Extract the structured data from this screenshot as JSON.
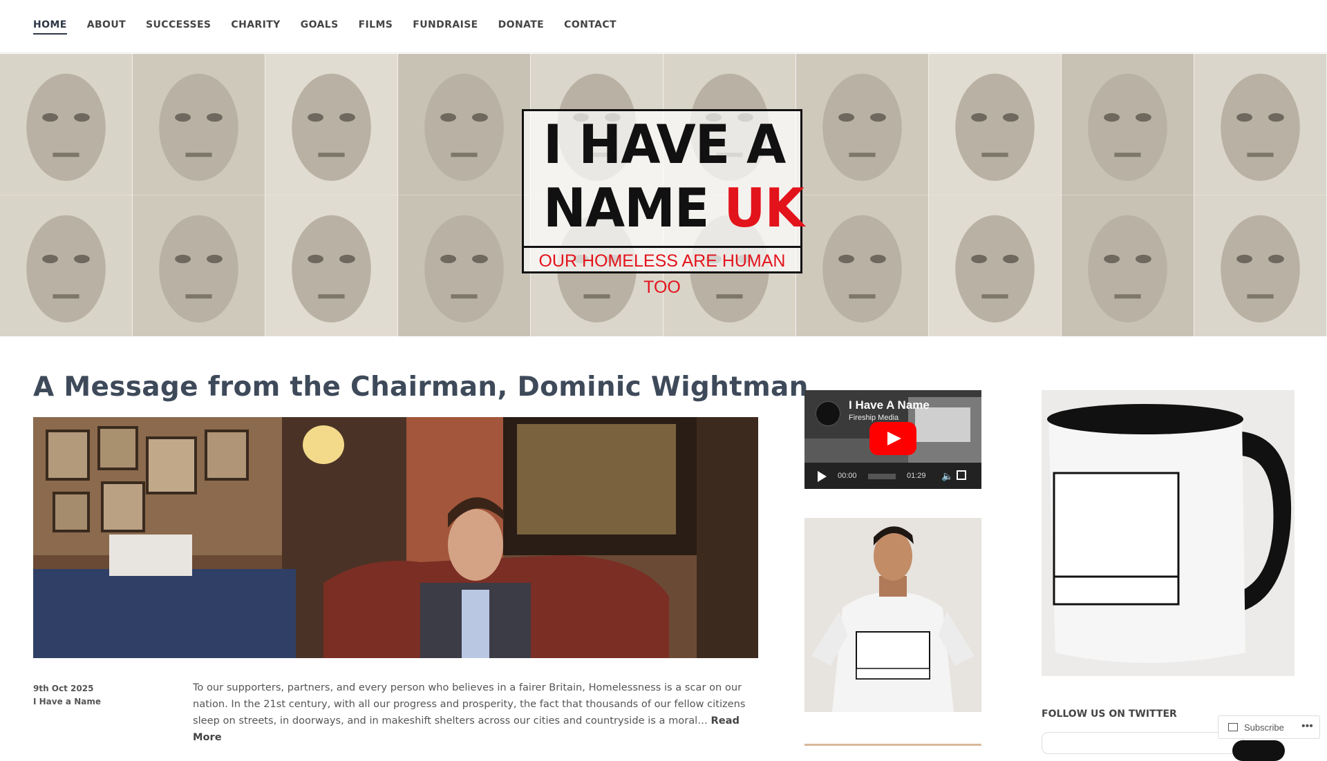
{
  "nav": {
    "items": [
      {
        "label": "HOME",
        "active": true
      },
      {
        "label": "ABOUT"
      },
      {
        "label": "SUCCESSES"
      },
      {
        "label": "CHARITY"
      },
      {
        "label": "GOALS"
      },
      {
        "label": "FILMS"
      },
      {
        "label": "FUNDRAISE"
      },
      {
        "label": "DONATE"
      },
      {
        "label": "CONTACT"
      }
    ]
  },
  "header": {
    "logo_line1": "I HAVE A",
    "logo_line2": "NAME",
    "logo_uk": "UK",
    "logo_tagline": "OUR HOMELESS ARE HUMAN TOO"
  },
  "post": {
    "title": "A Message from the Chairman, Dominic Wightman",
    "date": "9th Oct 2025",
    "author": "I Have a Name",
    "excerpt": "To our supporters, partners, and every person who believes in a fairer Britain, Homelessness is a scar on our nation. In the 21st century, with all our progress and prosperity, the fact that thousands of our fellow citizens sleep on streets, in doorways, and in makeshift shelters across our cities and countryside is a moral…",
    "read_more": "Read More"
  },
  "video": {
    "title": "I Have A Name",
    "channel": "Fireship Media",
    "time_current": "00:00",
    "time_total": "01:29"
  },
  "sidebar": {
    "follow_heading": "FOLLOW US ON TWITTER"
  },
  "subscribe": {
    "label": "Subscribe",
    "more": "•••"
  },
  "colors": {
    "accent": "#e3131b",
    "title": "#3e4a5a",
    "youtube": "#ff0000"
  }
}
